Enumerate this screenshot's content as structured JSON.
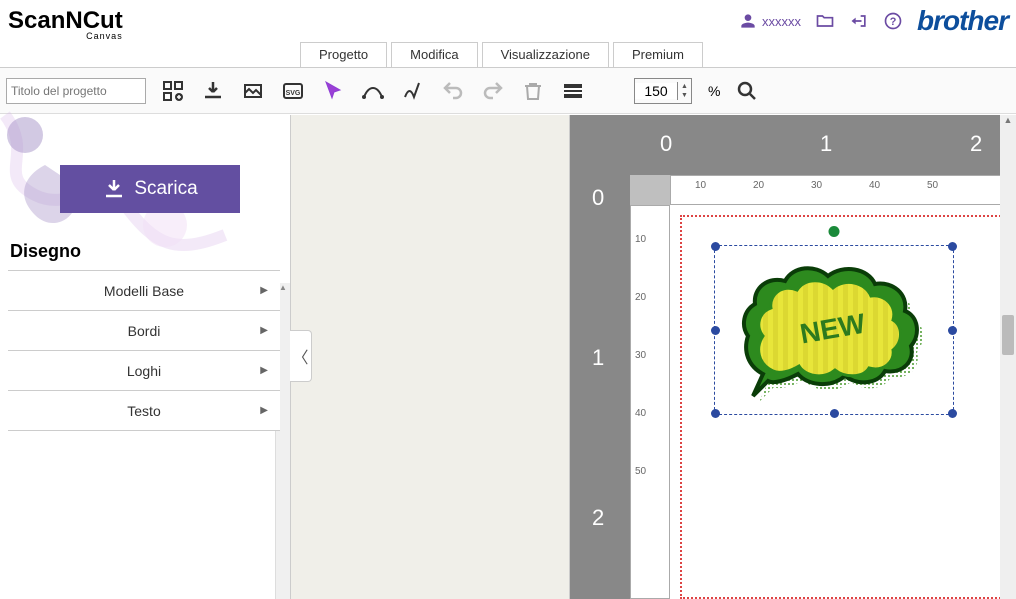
{
  "header": {
    "logo": "ScanNCut",
    "logo_sub": "Canvas",
    "user": "xxxxxx",
    "brother": "brother"
  },
  "tabs": [
    "Progetto",
    "Modifica",
    "Visualizzazione",
    "Premium"
  ],
  "toolbar": {
    "title_placeholder": "Titolo del progetto",
    "zoom": "150",
    "zoom_unit": "%"
  },
  "left": {
    "download": "Scarica",
    "section": "Disegno",
    "items": [
      "Modelli Base",
      "Bordi",
      "Loghi",
      "Testo"
    ]
  },
  "ruler": {
    "h_major": [
      "0",
      "1",
      "2"
    ],
    "v_major": [
      "0",
      "1",
      "2"
    ],
    "h_minor": [
      "10",
      "20",
      "30",
      "40",
      "50"
    ],
    "v_minor": [
      "10",
      "20",
      "30",
      "40",
      "50"
    ]
  },
  "shape_text": "NEW"
}
